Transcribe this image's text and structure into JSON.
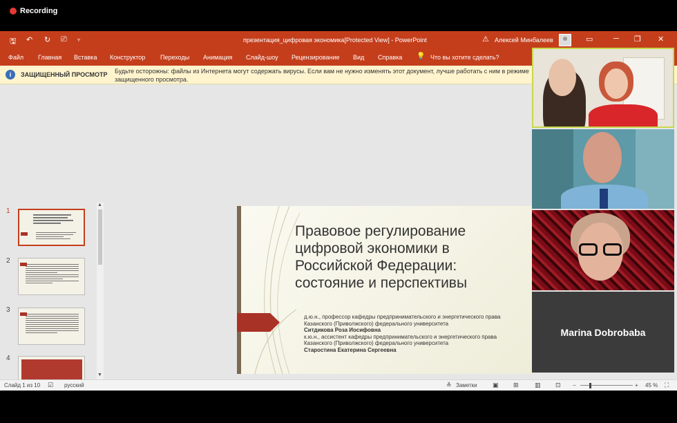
{
  "recording": {
    "label": "Recording",
    "color": "#e53935"
  },
  "powerpoint": {
    "title": "презентация_цифровая экономика[Protected View]  -  PowerPoint",
    "user": "Алексей Минбалеев",
    "accent": "#c43e1c",
    "ribbon": [
      "Файл",
      "Главная",
      "Вставка",
      "Конструктор",
      "Переходы",
      "Анимация",
      "Слайд-шоу",
      "Рецензирование",
      "Вид",
      "Справка",
      "Что вы хотите сделать?"
    ],
    "protected_view": {
      "label": "ЗАЩИЩЕННЫЙ ПРОСМОТР",
      "message": "Будьте осторожны: файлы из Интернета могут содержать вирусы. Если вам не нужно изменять этот документ, лучше работать с ним в режиме защищенного просмотра."
    },
    "thumbnails": [
      "1",
      "2",
      "3",
      "4"
    ],
    "slide": {
      "title": "Правовое регулирование цифровой экономики в Российской Федерации: состояние и перспективы",
      "line1": "д.ю.н., профессор кафедры предпринимательского и энергетического права",
      "line2": "Казанского (Приволжского) федерального университета",
      "name1": "Ситдикова Роза Иосифовна",
      "line3": "к.ю.н., ассистент кафедры предпринимательского и энергетического права",
      "line4": "Казанского (Приволжского) федерального университета",
      "name2": "Старостина Екатерина Сергеевна"
    },
    "status": {
      "slide_count": "Слайд 1 из 10",
      "language": "русский",
      "notes": "Заметки",
      "zoom_minus": "−",
      "zoom_plus": "+",
      "zoom": "45 %"
    }
  },
  "participants": {
    "tile4_name": "Marina Dobrobaba"
  }
}
